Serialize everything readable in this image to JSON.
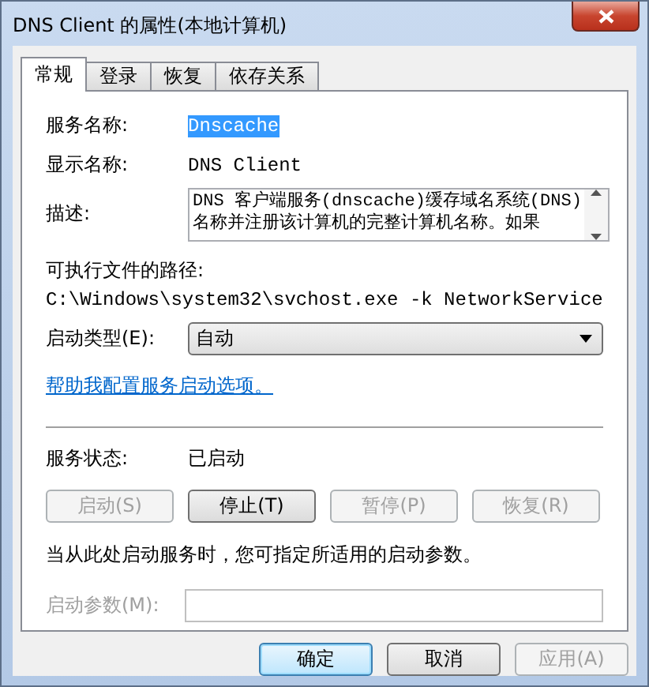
{
  "window": {
    "title": "DNS Client 的属性(本地计算机)"
  },
  "tabs": [
    {
      "label": "常规",
      "selected": true
    },
    {
      "label": "登录",
      "selected": false
    },
    {
      "label": "恢复",
      "selected": false
    },
    {
      "label": "依存关系",
      "selected": false
    }
  ],
  "service_name": {
    "label": "服务名称:",
    "value": "Dnscache",
    "selected": true
  },
  "display_name": {
    "label": "显示名称:",
    "value": "DNS Client"
  },
  "description": {
    "label": "描述:",
    "lines": [
      "DNS 客户端服务(dnscache)缓存域名系统(DNS)",
      "名称并注册该计算机的完整计算机名称。如果"
    ]
  },
  "executable": {
    "label": "可执行文件的路径:",
    "value": "C:\\Windows\\system32\\svchost.exe -k NetworkService"
  },
  "startup_type": {
    "label": "启动类型(E):",
    "value": "自动"
  },
  "help_link": "帮助我配置服务启动选项。",
  "service_status": {
    "label": "服务状态:",
    "value": "已启动"
  },
  "service_buttons": [
    {
      "label": "启动(S)",
      "disabled": true
    },
    {
      "label": "停止(T)",
      "disabled": false
    },
    {
      "label": "暂停(P)",
      "disabled": true
    },
    {
      "label": "恢复(R)",
      "disabled": true
    }
  ],
  "hint": "当从此处启动服务时，您可指定所适用的启动参数。",
  "start_params": {
    "label": "启动参数(M):",
    "disabled": true
  },
  "dialog_buttons": [
    {
      "label": "确定",
      "default": true,
      "disabled": false
    },
    {
      "label": "取消",
      "default": false,
      "disabled": false
    },
    {
      "label": "应用(A)",
      "default": false,
      "disabled": true
    }
  ]
}
